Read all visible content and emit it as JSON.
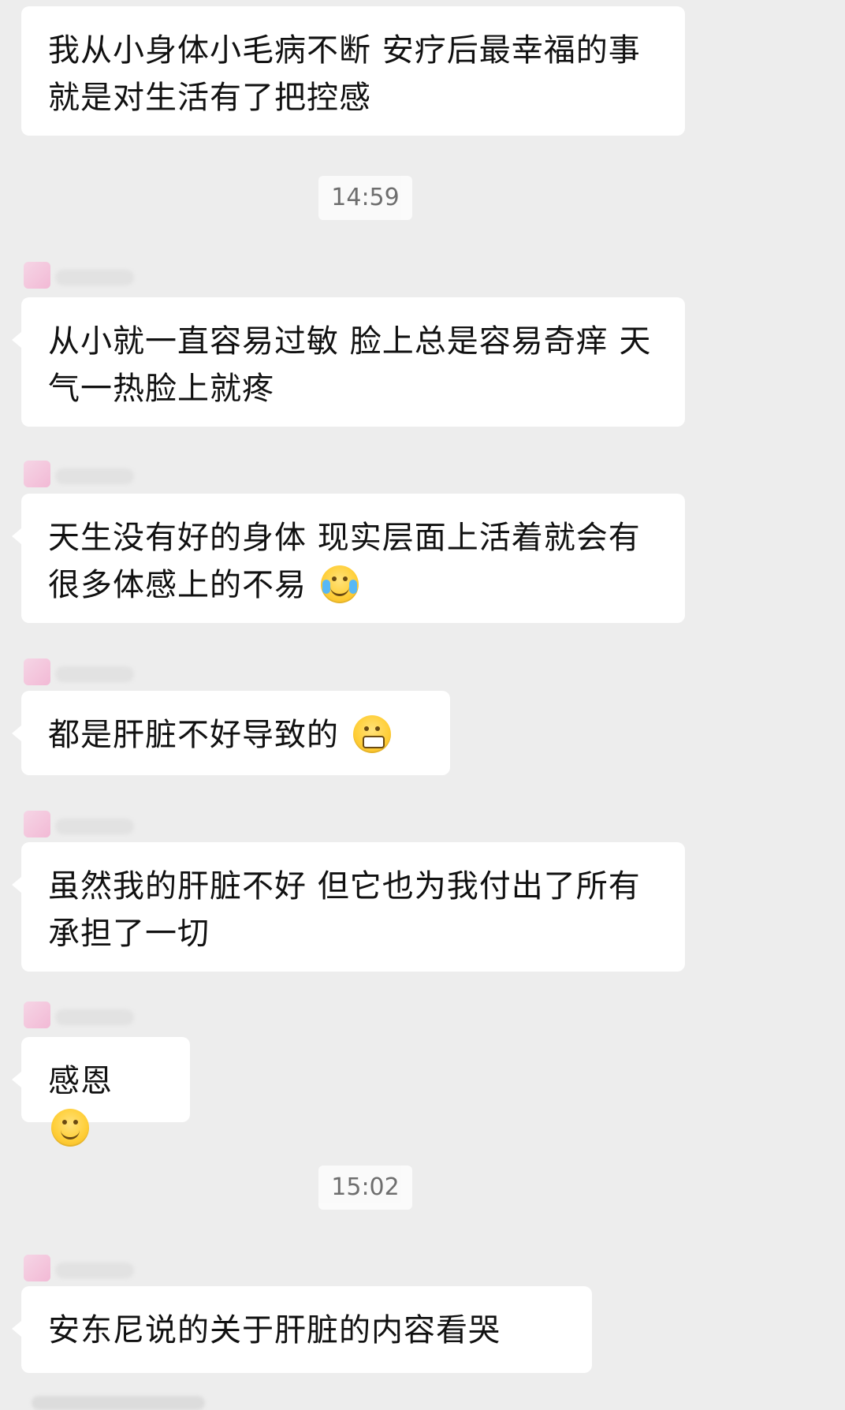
{
  "chat": {
    "timestamps": [
      "14:59",
      "15:02"
    ],
    "messages": [
      {
        "text": "我从小身体小毛病不断 安疗后最幸福的事就是对生活有了把控感",
        "emoji": ""
      },
      {
        "text": "从小就一直容易过敏 脸上总是容易奇痒 天气一热脸上就疼",
        "emoji": ""
      },
      {
        "text": "天生没有好的身体 现实层面上活着就会有很多体感上的不易",
        "emoji": "laugh-cry-emoji"
      },
      {
        "text": "都是肝脏不好导致的",
        "emoji": "grin-emoji"
      },
      {
        "text": "虽然我的肝脏不好 但它也为我付出了所有 承担了一切",
        "emoji": ""
      },
      {
        "text": "感恩",
        "emoji": "smile-emoji"
      },
      {
        "text": "安东尼说的关于肝脏的内容看哭",
        "emoji": ""
      }
    ]
  },
  "colors": {
    "background": "#ededed",
    "bubble": "#ffffff",
    "text": "#111111"
  }
}
